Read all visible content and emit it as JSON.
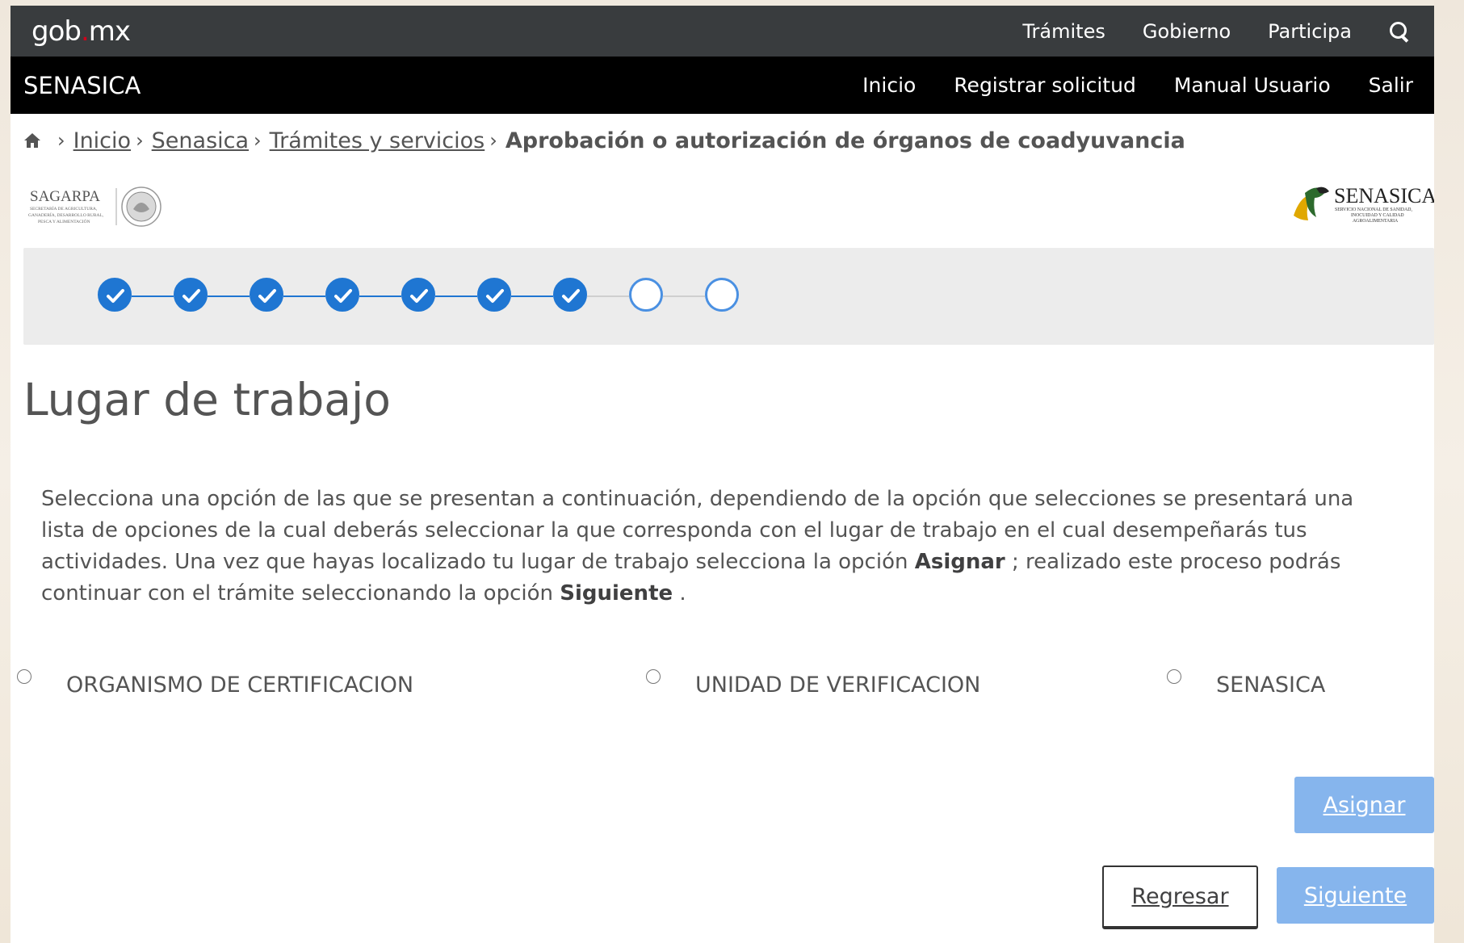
{
  "govbar": {
    "logo_main": "gob",
    "logo_dot": ".",
    "logo_tail": "mx",
    "nav": [
      "Trámites",
      "Gobierno",
      "Participa"
    ]
  },
  "subbar": {
    "title": "SENASICA",
    "nav": [
      "Inicio",
      "Registrar solicitud",
      "Manual Usuario",
      "Salir"
    ]
  },
  "breadcrumb": {
    "items": [
      "Inicio",
      "Senasica",
      "Trámites y servicios"
    ],
    "current": "Aprobación o autorización de órganos de coadyuvancia"
  },
  "logos": {
    "sagarpa_text": "SAGARPA",
    "sagarpa_sub1": "SECRETARÍA DE AGRICULTURA,",
    "sagarpa_sub2": "GANADERÍA, DESARROLLO RURAL,",
    "sagarpa_sub3": "PESCA Y ALIMENTACIÓN",
    "senasica_text": "SENASICA",
    "senasica_sub1": "SERVICIO NACIONAL DE SANIDAD,",
    "senasica_sub2": "INOCUIDAD Y CALIDAD",
    "senasica_sub3": "AGROALIMENTARIA"
  },
  "stepper": {
    "total_steps": 9,
    "completed_steps": 7,
    "colors": {
      "done": "#1f76d2",
      "todo_border": "#4a90e2",
      "line_done": "#1f76d2",
      "line_todo": "#cfcfcf"
    }
  },
  "page": {
    "title": "Lugar de trabajo",
    "instructions_1": "Selecciona una opción de las que se presentan a continuación, dependiendo de la opción que selecciones se presentará una lista de opciones de la cual deberás seleccionar la que corresponda con el lugar de trabajo en el cual desempeñarás tus actividades. Una vez que hayas localizado tu lugar de trabajo selecciona la opción ",
    "instructions_bold_1": "Asignar",
    "instructions_2": " ; realizado este proceso podrás continuar con el trámite seleccionando la opción ",
    "instructions_bold_2": "Siguiente",
    "instructions_3": " ."
  },
  "radios": [
    {
      "label": "ORGANISMO DE CERTIFICACION",
      "selected": false
    },
    {
      "label": "UNIDAD DE VERIFICACION",
      "selected": false
    },
    {
      "label": "SENASICA",
      "selected": false
    }
  ],
  "buttons": {
    "assign": "Asignar",
    "back": "Regresar",
    "next": "Siguiente"
  }
}
